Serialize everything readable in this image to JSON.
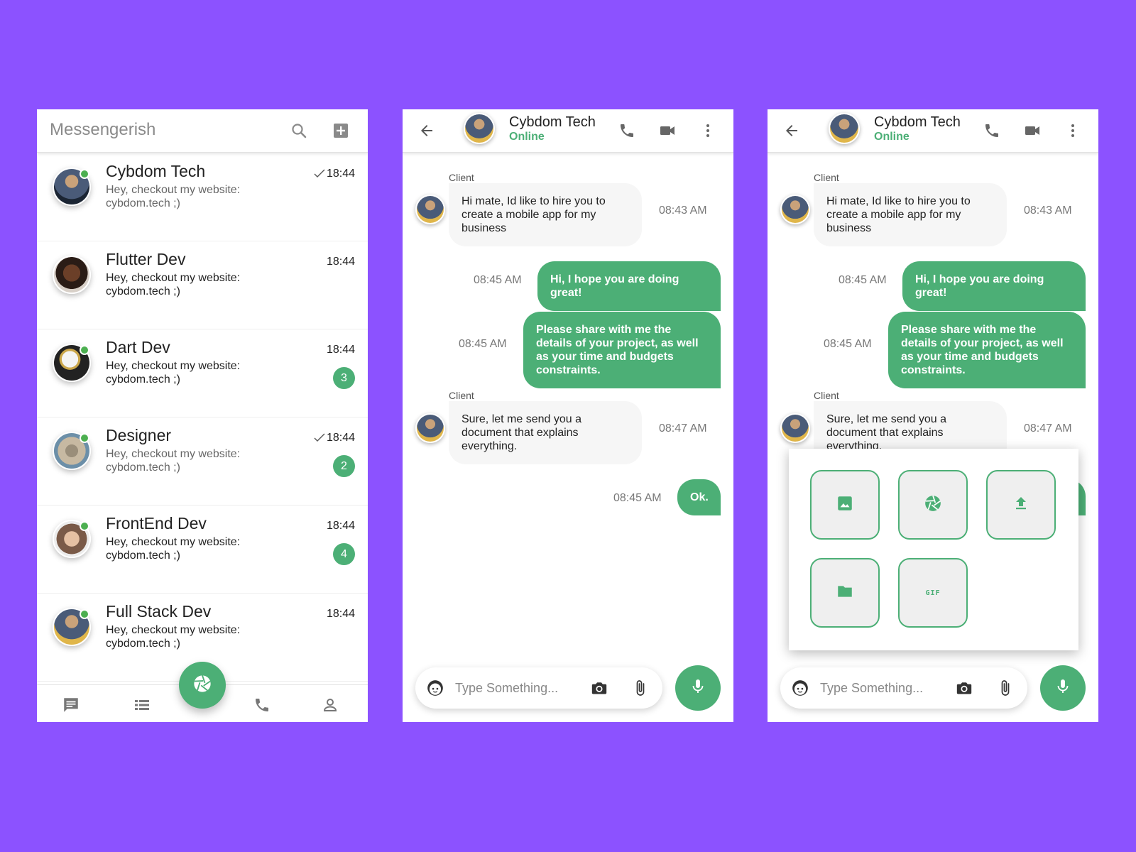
{
  "colors": {
    "background": "#8c52ff",
    "accent": "#4caf76",
    "online": "#4caf50"
  },
  "list_screen": {
    "app_title": "Messengerish",
    "header_icons": [
      "search-icon",
      "add-box-icon"
    ],
    "conversations": [
      {
        "name": "Cybdom Tech",
        "message": "Hey, checkout my website: cybdom.tech ;)",
        "time": "18:44",
        "read_check": true,
        "unread_count": "",
        "online": true
      },
      {
        "name": "Flutter Dev",
        "message": "Hey, checkout my website: cybdom.tech ;)",
        "time": "18:44",
        "read_check": false,
        "unread_count": "",
        "online": false
      },
      {
        "name": "Dart Dev",
        "message": "Hey, checkout my website: cybdom.tech ;)",
        "time": "18:44",
        "read_check": false,
        "unread_count": "3",
        "online": true
      },
      {
        "name": "Designer",
        "message": "Hey, checkout my website: cybdom.tech ;)",
        "time": "18:44",
        "read_check": true,
        "unread_count": "2",
        "online": true
      },
      {
        "name": "FrontEnd Dev",
        "message": "Hey, checkout my website: cybdom.tech ;)",
        "time": "18:44",
        "read_check": false,
        "unread_count": "4",
        "online": true
      },
      {
        "name": "Full Stack Dev",
        "message": "Hey, checkout my website: cybdom.tech ;)",
        "time": "18:44",
        "read_check": false,
        "unread_count": "",
        "online": true
      }
    ],
    "bottom_nav_icons": [
      "chat-icon",
      "list-icon",
      "camera-shutter-icon",
      "phone-icon",
      "person-icon"
    ]
  },
  "chat": {
    "contact_name": "Cybdom Tech",
    "contact_status": "Online",
    "header_icons": [
      "back-arrow-icon",
      "phone-icon",
      "videocam-icon",
      "more-vert-icon"
    ],
    "messages": [
      {
        "from": "client",
        "sender": "Client",
        "text": "Hi mate, Id like to hire you to create a mobile app for my business",
        "time": "08:43 AM"
      },
      {
        "from": "me",
        "text": "Hi, I hope you are doing great!",
        "time": "08:45 AM"
      },
      {
        "from": "me",
        "text": "Please share with me the details of your project, as well as your time and budgets constraints.",
        "time": "08:45 AM"
      },
      {
        "from": "client",
        "sender": "Client",
        "text": "Sure, let me send you a document that explains everything.",
        "time": "08:47 AM"
      },
      {
        "from": "me",
        "text": "Ok.",
        "time": "08:45 AM"
      }
    ],
    "input": {
      "placeholder": "Type Something...",
      "value": ""
    }
  },
  "attach_panel": {
    "options": [
      "image-icon",
      "camera-shutter-icon",
      "upload-icon",
      "folder-icon",
      "gif-icon"
    ],
    "gif_label": "GIF"
  }
}
